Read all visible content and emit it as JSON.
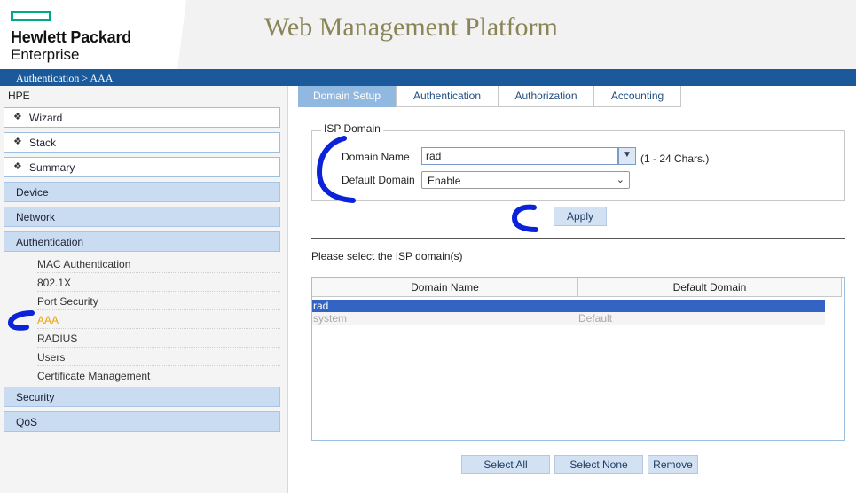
{
  "header": {
    "logo_line1": "Hewlett Packard",
    "logo_line2": "Enterprise",
    "title": "Web Management Platform",
    "breadcrumb": "Authentication > AAA"
  },
  "sidebar": {
    "root": "HPE",
    "top_items": [
      {
        "label": "Wizard"
      },
      {
        "label": "Stack"
      },
      {
        "label": "Summary"
      }
    ],
    "categories": [
      {
        "label": "Device"
      },
      {
        "label": "Network"
      },
      {
        "label": "Authentication"
      }
    ],
    "sub_items": [
      {
        "label": "MAC Authentication"
      },
      {
        "label": "802.1X"
      },
      {
        "label": "Port Security"
      },
      {
        "label": "AAA"
      },
      {
        "label": "RADIUS"
      },
      {
        "label": "Users"
      },
      {
        "label": "Certificate Management"
      }
    ],
    "bottom_categories": [
      {
        "label": "Security"
      },
      {
        "label": "QoS"
      }
    ]
  },
  "tabs": [
    {
      "label": "Domain Setup"
    },
    {
      "label": "Authentication"
    },
    {
      "label": "Authorization"
    },
    {
      "label": "Accounting"
    }
  ],
  "form": {
    "legend": "ISP Domain",
    "domain_name_label": "Domain Name",
    "domain_name_value": "rad",
    "char_hint": "(1 - 24 Chars.)",
    "default_domain_label": "Default Domain",
    "default_domain_value": "Enable",
    "apply_label": "Apply"
  },
  "table": {
    "prompt": "Please select the ISP domain(s)",
    "headers": [
      "Domain Name",
      "Default Domain"
    ],
    "rows": [
      {
        "name": "rad",
        "default": ""
      },
      {
        "name": "system",
        "default": "Default"
      }
    ]
  },
  "actions": {
    "select_all": "Select All",
    "select_none": "Select None",
    "remove": "Remove"
  },
  "colors": {
    "accent_blue": "#1b5a9a",
    "logo_green": "#01a982",
    "title_olive": "#8a8456",
    "selected_row": "#3364c4",
    "annotation_blue": "#0a22d8",
    "active_link": "#f0a000"
  }
}
